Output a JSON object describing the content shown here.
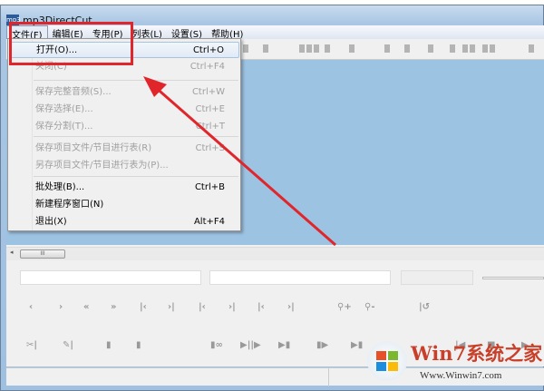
{
  "window": {
    "title": "mp3DirectCut",
    "icon": "mp3-app-icon",
    "icon_text": "mp3"
  },
  "menubar": [
    "文件(F)",
    "编辑(E)",
    "专用(P)",
    "列表(L)",
    "设置(S)",
    "帮助(H)"
  ],
  "file_menu": [
    {
      "label": "打开(O)...",
      "shortcut": "Ctrl+O",
      "enabled": true
    },
    {
      "label": "关闭(C)",
      "shortcut": "Ctrl+F4",
      "enabled": false
    },
    {
      "label": "保存完整音频(S)...",
      "shortcut": "Ctrl+W",
      "enabled": false
    },
    {
      "label": "保存选择(E)...",
      "shortcut": "Ctrl+E",
      "enabled": false
    },
    {
      "label": "保存分割(T)...",
      "shortcut": "Ctrl+T",
      "enabled": false
    },
    {
      "label": "保存项目文件/节目进行表(R)",
      "shortcut": "Ctrl+S",
      "enabled": false
    },
    {
      "label": "另存项目文件/节目进行表为(P)...",
      "shortcut": "",
      "enabled": false
    },
    {
      "label": "批处理(B)...",
      "shortcut": "Ctrl+B",
      "enabled": true
    },
    {
      "label": "新建程序窗口(N)",
      "shortcut": "",
      "enabled": true
    },
    {
      "label": "退出(X)",
      "shortcut": "Alt+F4",
      "enabled": true
    }
  ],
  "scroll_thumb": "III",
  "nav_buttons": [
    "‹",
    "›",
    "«",
    "»",
    "|‹",
    "›|",
    "|‹",
    "›|",
    "|‹",
    "›|",
    "⚲+",
    "⚲-",
    "|↺"
  ],
  "play_buttons": [
    "✂|",
    "✎|",
    "▮",
    "▮",
    "▮∞",
    "▶||▶",
    "▶▮",
    "▮▶",
    "▶▮",
    "▮▶",
    "|◀",
    "■",
    "▶"
  ],
  "watermark": {
    "brand": "Win7系统之家",
    "url": "Www.Winwin7.com"
  },
  "colors": {
    "annotation": "#e0262b",
    "wave_bg": "#9dc3e2"
  }
}
